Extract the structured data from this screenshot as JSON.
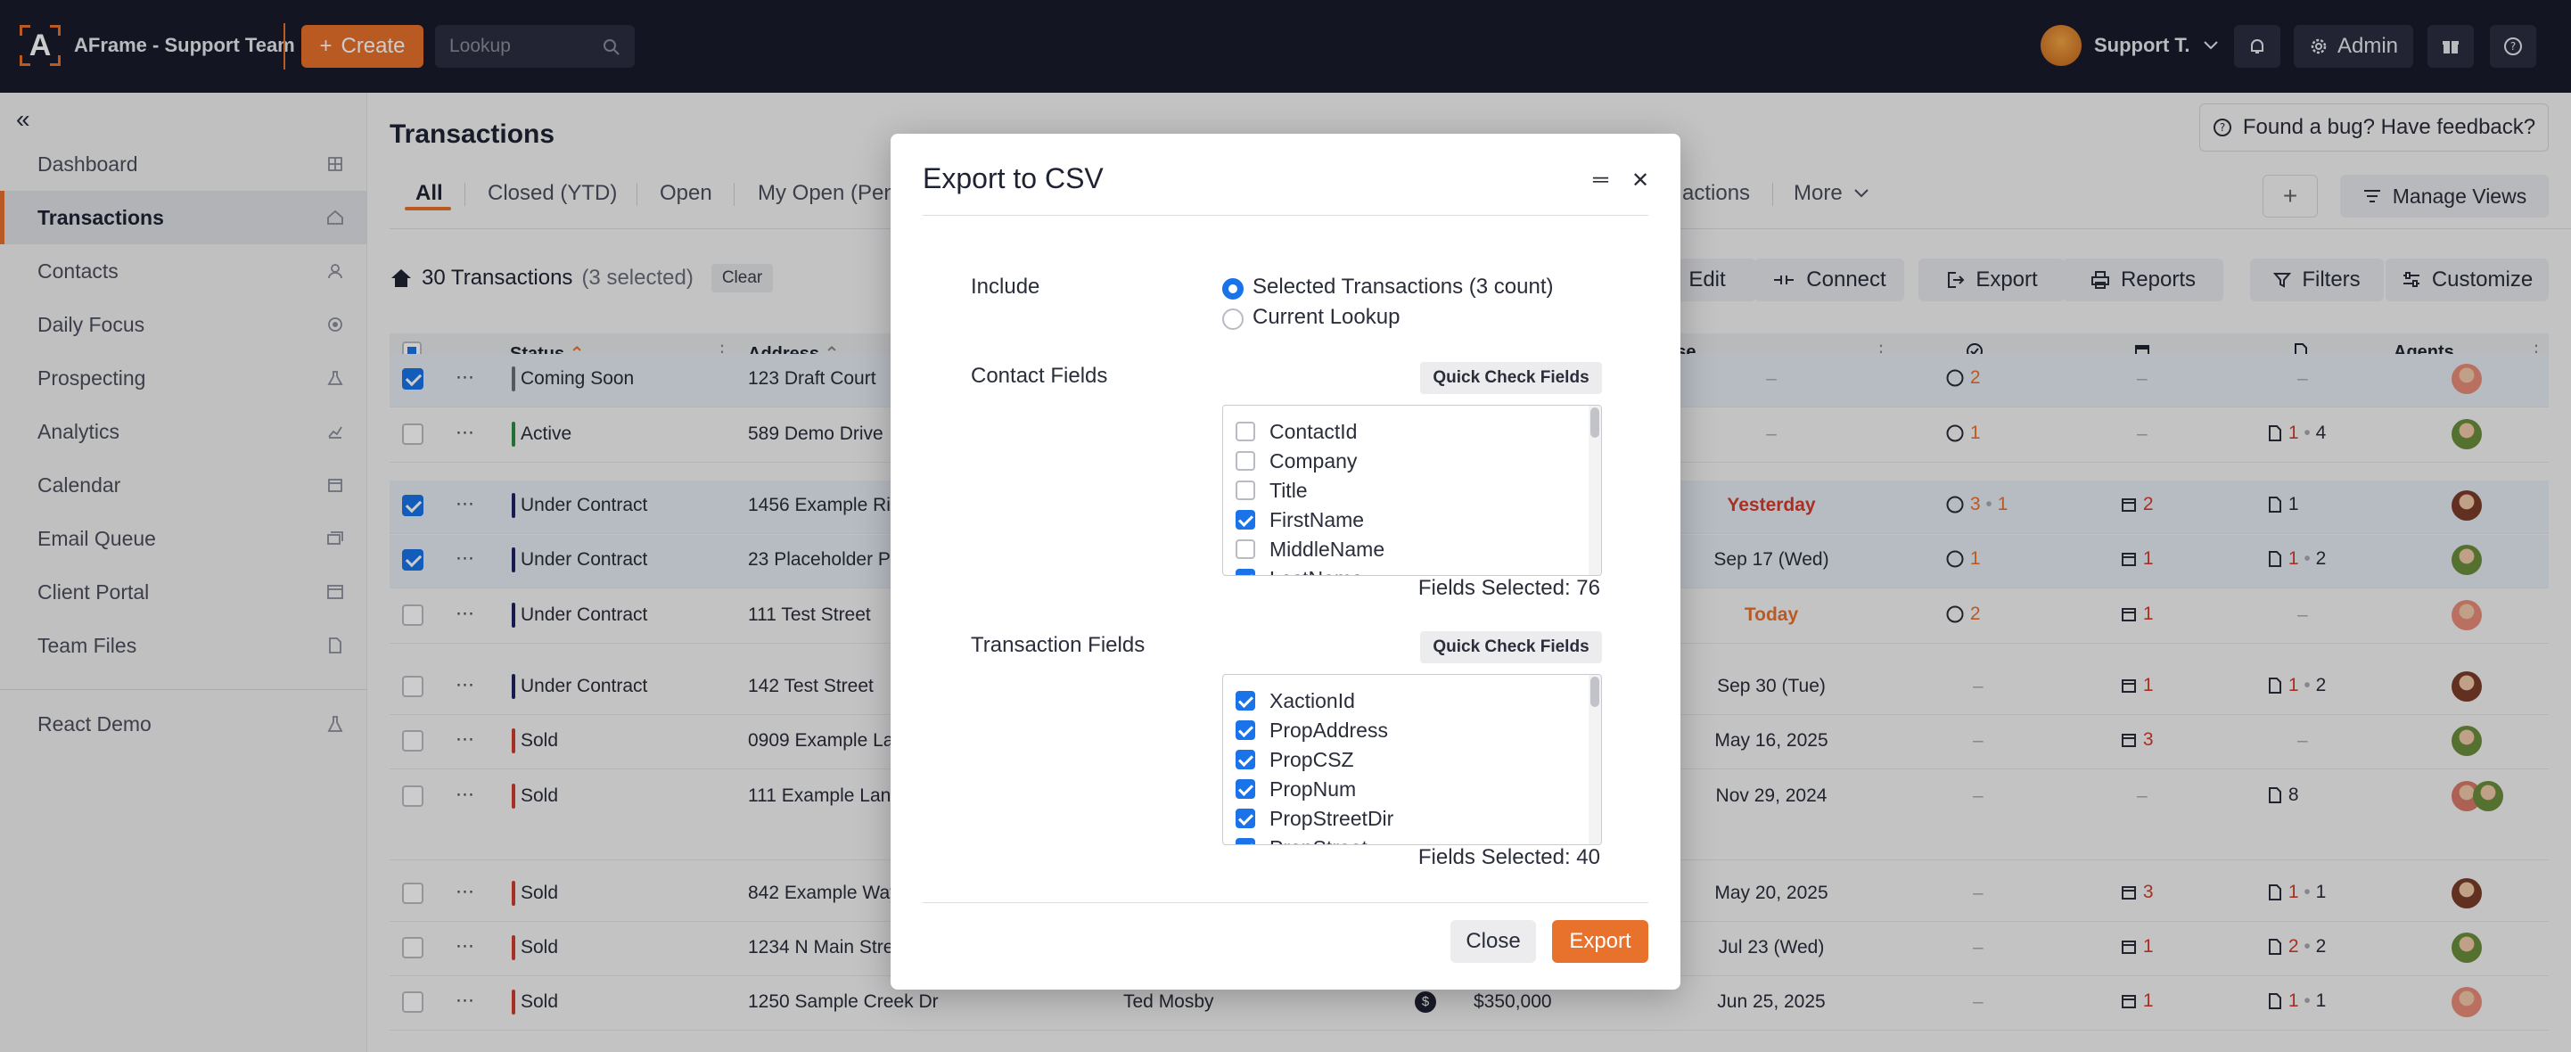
{
  "app": {
    "title": "AFrame - Support Team",
    "create_label": "Create",
    "lookup_placeholder": "Lookup",
    "user_name": "Support T.",
    "admin_label": "Admin",
    "accent": "#e8712c"
  },
  "sidebar": {
    "items": [
      {
        "label": "Dashboard",
        "icon": "grid-icon"
      },
      {
        "label": "Transactions",
        "icon": "house-icon",
        "active": true
      },
      {
        "label": "Contacts",
        "icon": "person-icon"
      },
      {
        "label": "Daily Focus",
        "icon": "target-icon"
      },
      {
        "label": "Prospecting",
        "icon": "flask-icon"
      },
      {
        "label": "Analytics",
        "icon": "chart-icon"
      },
      {
        "label": "Calendar",
        "icon": "calendar-icon"
      },
      {
        "label": "Email Queue",
        "icon": "mail-stack-icon"
      },
      {
        "label": "Client Portal",
        "icon": "window-icon"
      },
      {
        "label": "Team Files",
        "icon": "file-icon"
      }
    ],
    "extra_item": "React Demo"
  },
  "page": {
    "title": "Transactions",
    "feedback": "Found a bug? Have feedback?",
    "tabs": [
      "All",
      "Closed (YTD)",
      "Open",
      "My Open (Pen",
      "actions",
      "More"
    ],
    "manage_views": "Manage Views",
    "count_text": "30 Transactions",
    "selected_text": "(3 selected)",
    "clear_label": "Clear",
    "toolbar": {
      "edit": "Edit",
      "connect": "Connect",
      "export": "Export",
      "reports": "Reports",
      "filters": "Filters",
      "customize": "Customize"
    }
  },
  "table": {
    "headers": {
      "status": "Status",
      "address": "Address",
      "close": "ose",
      "agents": "Agents"
    },
    "rows": [
      {
        "checked": true,
        "status": "Coming Soon",
        "status_color": "#6a6f7c",
        "address": "123 Draft Court",
        "close": "–",
        "todo": "2",
        "todo2": "",
        "cal": "–",
        "docs": "–"
      },
      {
        "checked": false,
        "status": "Active",
        "status_color": "#2e8b3e",
        "address": "589 Demo Drive",
        "close": "–",
        "todo": "1",
        "todo2": "",
        "cal": "–",
        "docs": "1",
        "docs2": "4"
      },
      {
        "checked": true,
        "status": "Under Contract",
        "status_color": "#1d2266",
        "address": "1456 Example Rid",
        "close": "Yesterday",
        "todo": "3",
        "todo2": "1",
        "cal": "2",
        "docs": "1"
      },
      {
        "checked": true,
        "status": "Under Contract",
        "status_color": "#1d2266",
        "address": "23 Placeholder Pl",
        "close": "Sep 17 (Wed)",
        "todo": "1",
        "todo2": "",
        "cal": "1",
        "docs": "1",
        "docs2": "2"
      },
      {
        "checked": false,
        "status": "Under Contract",
        "status_color": "#1d2266",
        "address": "111 Test Street",
        "close": "Today",
        "todo": "2",
        "todo2": "",
        "cal": "1",
        "docs": "–"
      },
      {
        "checked": false,
        "status": "Under Contract",
        "status_color": "#1d2266",
        "address": "142 Test Street",
        "close": "Sep 30 (Tue)",
        "todo": "–",
        "todo2": "",
        "cal": "1",
        "docs": "1",
        "docs2": "2"
      },
      {
        "checked": false,
        "status": "Sold",
        "status_color": "#d33b2c",
        "address": "0909 Example La",
        "close": "May 16, 2025",
        "todo": "–",
        "todo2": "",
        "cal": "3",
        "docs": "–"
      },
      {
        "checked": false,
        "status": "Sold",
        "status_color": "#d33b2c",
        "address": "111 Example Lane",
        "close": "Nov 29, 2024",
        "todo": "–",
        "todo2": "",
        "cal": "–",
        "docs": "8"
      },
      {
        "checked": false,
        "status": "Sold",
        "status_color": "#d33b2c",
        "address": "842 Example Way",
        "close": "May 20, 2025",
        "todo": "–",
        "todo2": "",
        "cal": "3",
        "docs": "1",
        "docs2": "1"
      },
      {
        "checked": false,
        "status": "Sold",
        "status_color": "#d33b2c",
        "address": "1234 N Main Stree",
        "close": "Jul 23 (Wed)",
        "todo": "–",
        "todo2": "",
        "cal": "1",
        "docs": "2",
        "docs2": "2"
      },
      {
        "checked": false,
        "status": "Sold",
        "status_color": "#d33b2c",
        "address": "1250 Sample Creek Dr",
        "client": "Ted Mosby",
        "price": "$350,000",
        "close": "Jun 25, 2025",
        "todo": "–",
        "todo2": "",
        "cal": "1",
        "docs": "1",
        "docs2": "1"
      }
    ]
  },
  "modal": {
    "title": "Export to CSV",
    "include_label": "Include",
    "option_selected": "Selected Transactions (3 count)",
    "option_lookup": "Current Lookup",
    "contact_label": "Contact Fields",
    "transaction_label": "Transaction Fields",
    "quick_check": "Quick Check Fields",
    "contact_fields": [
      {
        "name": "ContactId",
        "checked": false
      },
      {
        "name": "Company",
        "checked": false
      },
      {
        "name": "Title",
        "checked": false
      },
      {
        "name": "FirstName",
        "checked": true
      },
      {
        "name": "MiddleName",
        "checked": false
      },
      {
        "name": "LastName",
        "checked": true
      }
    ],
    "contact_selected": "Fields Selected: 76",
    "transaction_fields": [
      {
        "name": "XactionId",
        "checked": true
      },
      {
        "name": "PropAddress",
        "checked": true
      },
      {
        "name": "PropCSZ",
        "checked": true
      },
      {
        "name": "PropNum",
        "checked": true
      },
      {
        "name": "PropStreetDir",
        "checked": true
      },
      {
        "name": "PropStreet",
        "checked": true
      }
    ],
    "transaction_selected": "Fields Selected: 40",
    "close_label": "Close",
    "export_label": "Export"
  }
}
